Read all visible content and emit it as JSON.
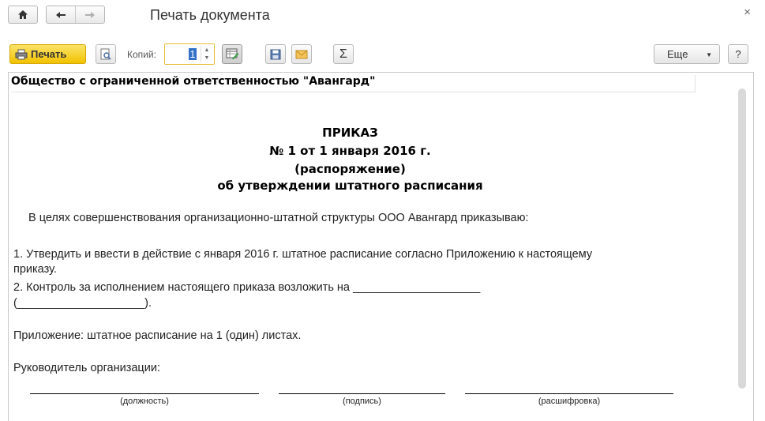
{
  "window": {
    "title": "Печать документа"
  },
  "nav": {
    "home_icon": "home-icon",
    "back_icon": "arrow-left-icon",
    "forward_icon": "arrow-right-icon",
    "close_glyph": "×"
  },
  "toolbar": {
    "print_label": "Печать",
    "copies_label": "Копий:",
    "copies_value": "1",
    "more_label": "Еще",
    "help_label": "?",
    "sigma_glyph": "Σ"
  },
  "document": {
    "org_header": "Общество с ограниченной ответственностью \"Авангард\"",
    "title_lines": [
      "ПРИКАЗ",
      "№ 1 от 1 января 2016 г.",
      "(распоряжение)",
      "об утверждении штатного расписания"
    ],
    "intro": "В целях совершенствования организационно-штатной структуры ООО Авангард приказываю:",
    "item1_line1": "1. Утвердить и ввести в действие с января 2016 г. штатное расписание согласно Приложению к настоящему",
    "item1_line2": "приказу.",
    "item2_line1": "2. Контроль за исполнением настоящего приказа возложить на ____________________",
    "item2_line2": "(____________________).",
    "appendix": "Приложение: штатное расписание на 1 (один) листах.",
    "head_label": "Руководитель организации:",
    "sign_captions": [
      "(должность)",
      "(подпись)",
      "(расшифровка)"
    ]
  }
}
